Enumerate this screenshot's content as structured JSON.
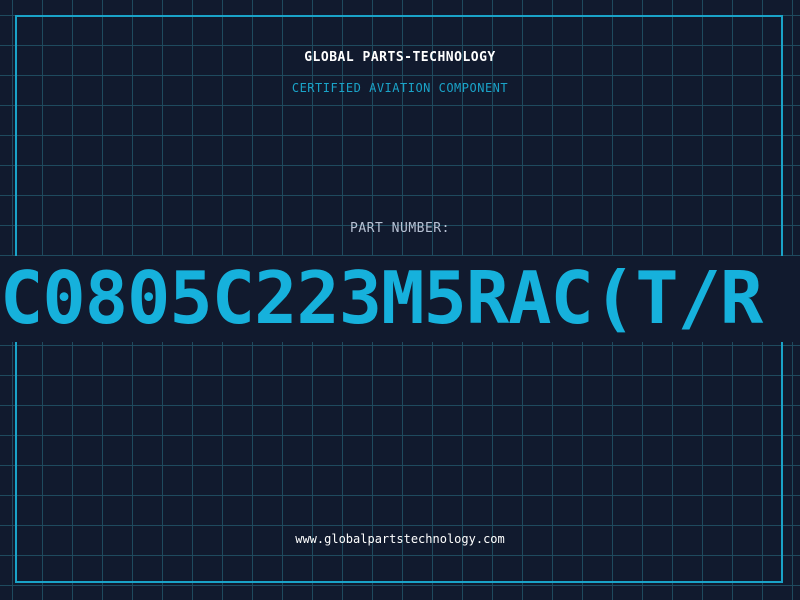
{
  "header": {
    "company": "GLOBAL PARTS-TECHNOLOGY",
    "tagline": "CERTIFIED AVIATION COMPONENT"
  },
  "part": {
    "label": "PART NUMBER:",
    "number": "C0805C223M5RAC(T/R"
  },
  "footer": {
    "url": "www.globalpartstechnology.com"
  },
  "colors": {
    "background": "#111a2e",
    "grid": "#1f4a5e",
    "accent": "#1aa3c8",
    "part_number": "#16b1dc",
    "text": "#ffffff"
  }
}
